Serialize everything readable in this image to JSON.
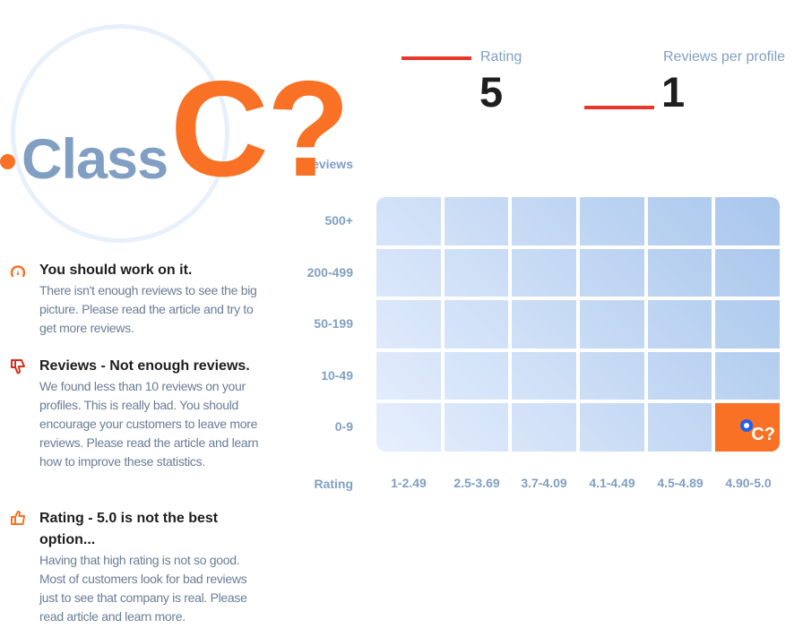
{
  "header": {
    "class_word": "Class",
    "grade": "C?"
  },
  "stats": [
    {
      "label": "Rating",
      "value": "5"
    },
    {
      "label": "Reviews per profile",
      "value": "1"
    }
  ],
  "insights": [
    {
      "icon": "gauge-icon",
      "icon_color": "#f97124",
      "title": "You should work on it.",
      "text": "There isn't enough reviews to see the big picture. Please read the article and try to get more reviews."
    },
    {
      "icon": "thumbs-down-icon",
      "icon_color": "#d92c1c",
      "title": "Reviews - Not enough reviews.",
      "text": "We found less than 10 reviews on your profiles. This is really bad. You should encourage your customers to leave more reviews. Please read the article and learn how to improve these statistics."
    },
    {
      "icon": "thumbs-up-icon",
      "icon_color": "#f97124",
      "title": "Rating - 5.0 is not the best option...",
      "text": "Having that high rating is not so good. Most of customers look for bad reviews just to see that company is real. Please read article and learn more."
    }
  ],
  "matrix": {
    "y_axis_title": "Reviews",
    "x_axis_title": "Rating",
    "rows": [
      "500+",
      "200-499",
      "50-199",
      "10-49",
      "0-9"
    ],
    "columns": [
      "1-2.49",
      "2.5-3.69",
      "3.7-4.09",
      "4.1-4.49",
      "4.5-4.89",
      "4.90-5.0"
    ],
    "highlight": {
      "row": "0-9",
      "column": "4.90-5.0",
      "label": "C?"
    },
    "colors": {
      "highlight": "#f97124",
      "light": "#e6effd",
      "dark": "#a8c6ec",
      "marker": "#1e5ef0"
    }
  }
}
